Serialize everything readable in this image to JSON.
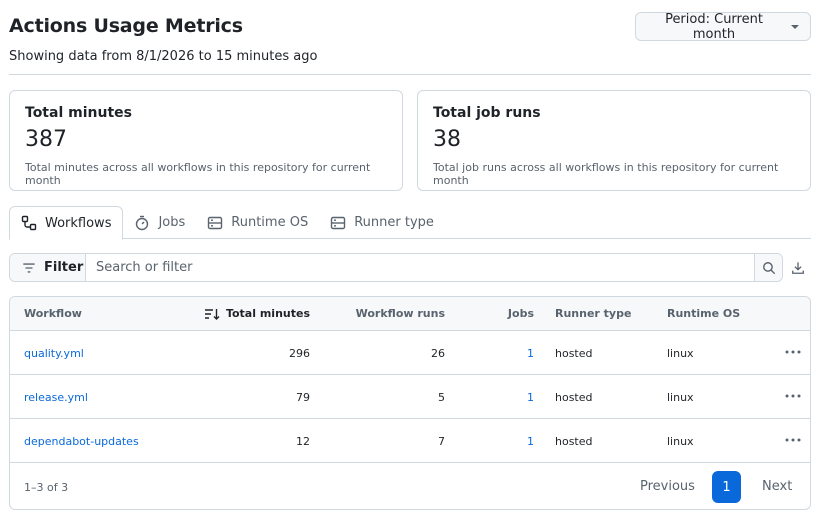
{
  "header": {
    "title": "Actions Usage Metrics",
    "subtitle": "Showing data from 8/1/2026 to 15 minutes ago",
    "period_label": "Period: Current month"
  },
  "cards": [
    {
      "title": "Total minutes",
      "value": "387",
      "description": "Total minutes across all workflows in this repository for current month"
    },
    {
      "title": "Total job runs",
      "value": "38",
      "description": "Total job runs across all workflows in this repository for current month"
    }
  ],
  "tabs": [
    {
      "label": "Workflows",
      "icon": "workflow-icon",
      "active": true
    },
    {
      "label": "Jobs",
      "icon": "stopwatch-icon",
      "active": false
    },
    {
      "label": "Runtime OS",
      "icon": "server-icon",
      "active": false
    },
    {
      "label": "Runner type",
      "icon": "server-icon",
      "active": false
    }
  ],
  "filter": {
    "button_label": "Filter",
    "placeholder": "Search or filter"
  },
  "table": {
    "columns": [
      "Workflow",
      "Total minutes",
      "Workflow runs",
      "Jobs",
      "Runner type",
      "Runtime OS"
    ],
    "sorted_column": "Total minutes",
    "rows": [
      {
        "workflow": "quality.yml",
        "minutes": "296",
        "runs": "26",
        "jobs": "1",
        "runner": "hosted",
        "os": "linux"
      },
      {
        "workflow": "release.yml",
        "minutes": "79",
        "runs": "5",
        "jobs": "1",
        "runner": "hosted",
        "os": "linux"
      },
      {
        "workflow": "dependabot-updates",
        "minutes": "12",
        "runs": "7",
        "jobs": "1",
        "runner": "hosted",
        "os": "linux"
      }
    ]
  },
  "pagination": {
    "summary": "1–3 of 3",
    "previous": "Previous",
    "current": "1",
    "next": "Next"
  },
  "colors": {
    "accent": "#0969da",
    "border": "#d1d9e0",
    "muted": "#59636e",
    "text": "#1f2328",
    "subtle_bg": "#f6f8fa"
  }
}
